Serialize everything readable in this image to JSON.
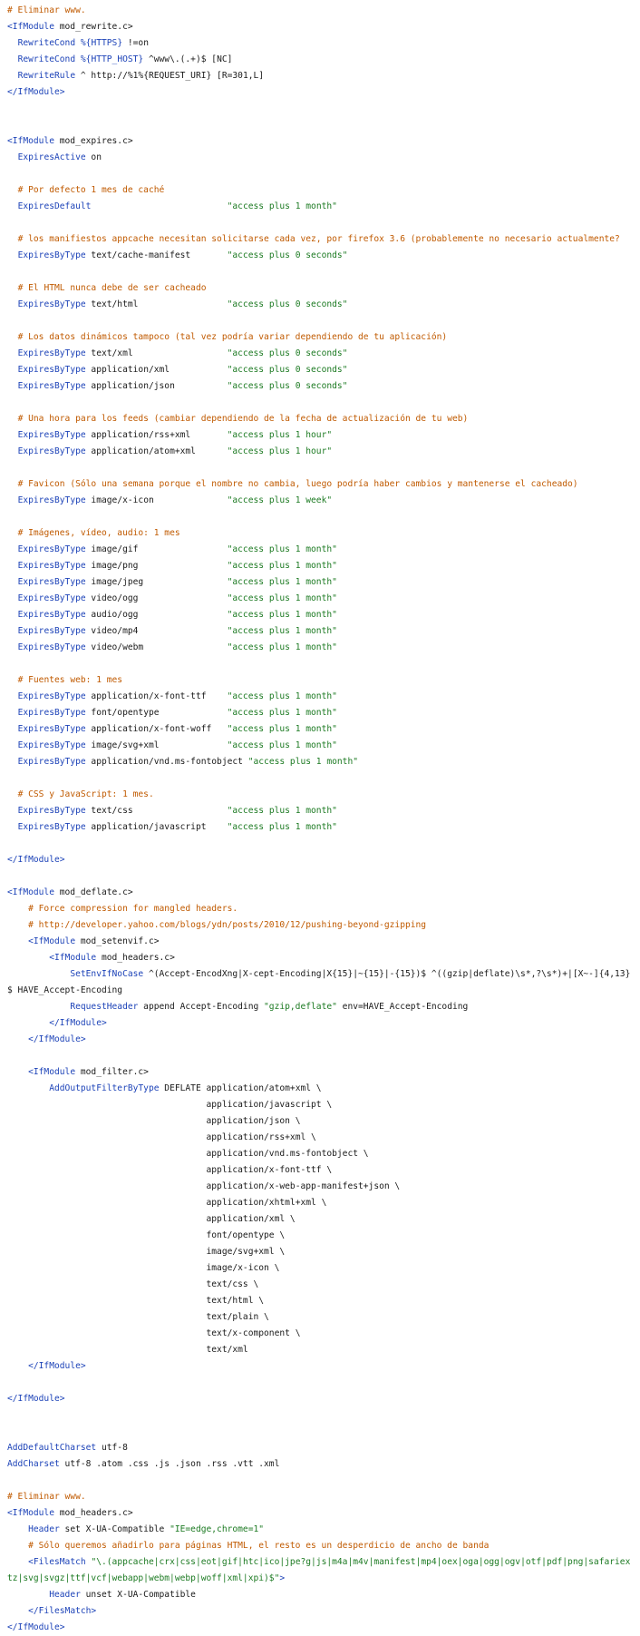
{
  "document": {
    "language": "apache-config",
    "colors": {
      "comment": "#c05a00",
      "directive": "#1d43b8",
      "string": "#1c7a22",
      "text": "#1a1a1a",
      "background": "#ffffff"
    },
    "lines": [
      [
        [
          "c",
          "# Eliminar www."
        ]
      ],
      [
        [
          "d",
          "<IfModule"
        ],
        [
          "t",
          " mod_rewrite.c>"
        ]
      ],
      [
        [
          "t",
          "  "
        ],
        [
          "d",
          "RewriteCond"
        ],
        [
          "t",
          " "
        ],
        [
          "d",
          "%{HTTPS}"
        ],
        [
          "t",
          " !=on"
        ]
      ],
      [
        [
          "t",
          "  "
        ],
        [
          "d",
          "RewriteCond"
        ],
        [
          "t",
          " "
        ],
        [
          "d",
          "%{HTTP_HOST}"
        ],
        [
          "t",
          " ^www\\.(.+)$ [NC]"
        ]
      ],
      [
        [
          "t",
          "  "
        ],
        [
          "d",
          "RewriteRule"
        ],
        [
          "t",
          " ^ http://%1%{REQUEST_URI} [R=301,L]"
        ]
      ],
      [
        [
          "d",
          "</IfModule>"
        ]
      ],
      [],
      [],
      [
        [
          "d",
          "<IfModule"
        ],
        [
          "t",
          " mod_expires.c>"
        ]
      ],
      [
        [
          "t",
          "  "
        ],
        [
          "d",
          "ExpiresActive"
        ],
        [
          "t",
          " on"
        ]
      ],
      [],
      [
        [
          "c",
          "  # Por defecto 1 mes de caché"
        ]
      ],
      [
        [
          "t",
          "  "
        ],
        [
          "d",
          "ExpiresDefault"
        ],
        [
          "t",
          "                          "
        ],
        [
          "s",
          "\"access plus 1 month\""
        ]
      ],
      [],
      [
        [
          "c",
          "  # los manifiestos appcache necesitan solicitarse cada vez, por firefox 3.6 (probablemente no necesario actualmente?"
        ]
      ],
      [
        [
          "t",
          "  "
        ],
        [
          "d",
          "ExpiresByType"
        ],
        [
          "t",
          " text/cache-manifest       "
        ],
        [
          "s",
          "\"access plus 0 seconds\""
        ]
      ],
      [],
      [
        [
          "c",
          "  # El HTML nunca debe de ser cacheado"
        ]
      ],
      [
        [
          "t",
          "  "
        ],
        [
          "d",
          "ExpiresByType"
        ],
        [
          "t",
          " text/html                 "
        ],
        [
          "s",
          "\"access plus 0 seconds\""
        ]
      ],
      [],
      [
        [
          "c",
          "  # Los datos dinámicos tampoco (tal vez podría variar dependiendo de tu aplicación)"
        ]
      ],
      [
        [
          "t",
          "  "
        ],
        [
          "d",
          "ExpiresByType"
        ],
        [
          "t",
          " text/xml                  "
        ],
        [
          "s",
          "\"access plus 0 seconds\""
        ]
      ],
      [
        [
          "t",
          "  "
        ],
        [
          "d",
          "ExpiresByType"
        ],
        [
          "t",
          " application/xml           "
        ],
        [
          "s",
          "\"access plus 0 seconds\""
        ]
      ],
      [
        [
          "t",
          "  "
        ],
        [
          "d",
          "ExpiresByType"
        ],
        [
          "t",
          " application/json          "
        ],
        [
          "s",
          "\"access plus 0 seconds\""
        ]
      ],
      [],
      [
        [
          "c",
          "  # Una hora para los feeds (cambiar dependiendo de la fecha de actualización de tu web)"
        ]
      ],
      [
        [
          "t",
          "  "
        ],
        [
          "d",
          "ExpiresByType"
        ],
        [
          "t",
          " application/rss+xml       "
        ],
        [
          "s",
          "\"access plus 1 hour\""
        ]
      ],
      [
        [
          "t",
          "  "
        ],
        [
          "d",
          "ExpiresByType"
        ],
        [
          "t",
          " application/atom+xml      "
        ],
        [
          "s",
          "\"access plus 1 hour\""
        ]
      ],
      [],
      [
        [
          "c",
          "  # Favicon (Sólo una semana porque el nombre no cambia, luego podría haber cambios y mantenerse el cacheado)"
        ]
      ],
      [
        [
          "t",
          "  "
        ],
        [
          "d",
          "ExpiresByType"
        ],
        [
          "t",
          " image/x-icon              "
        ],
        [
          "s",
          "\"access plus 1 week\""
        ]
      ],
      [],
      [
        [
          "c",
          "  # Imágenes, vídeo, audio: 1 mes"
        ]
      ],
      [
        [
          "t",
          "  "
        ],
        [
          "d",
          "ExpiresByType"
        ],
        [
          "t",
          " image/gif                 "
        ],
        [
          "s",
          "\"access plus 1 month\""
        ]
      ],
      [
        [
          "t",
          "  "
        ],
        [
          "d",
          "ExpiresByType"
        ],
        [
          "t",
          " image/png                 "
        ],
        [
          "s",
          "\"access plus 1 month\""
        ]
      ],
      [
        [
          "t",
          "  "
        ],
        [
          "d",
          "ExpiresByType"
        ],
        [
          "t",
          " image/jpeg                "
        ],
        [
          "s",
          "\"access plus 1 month\""
        ]
      ],
      [
        [
          "t",
          "  "
        ],
        [
          "d",
          "ExpiresByType"
        ],
        [
          "t",
          " video/ogg                 "
        ],
        [
          "s",
          "\"access plus 1 month\""
        ]
      ],
      [
        [
          "t",
          "  "
        ],
        [
          "d",
          "ExpiresByType"
        ],
        [
          "t",
          " audio/ogg                 "
        ],
        [
          "s",
          "\"access plus 1 month\""
        ]
      ],
      [
        [
          "t",
          "  "
        ],
        [
          "d",
          "ExpiresByType"
        ],
        [
          "t",
          " video/mp4                 "
        ],
        [
          "s",
          "\"access plus 1 month\""
        ]
      ],
      [
        [
          "t",
          "  "
        ],
        [
          "d",
          "ExpiresByType"
        ],
        [
          "t",
          " video/webm                "
        ],
        [
          "s",
          "\"access plus 1 month\""
        ]
      ],
      [],
      [
        [
          "c",
          "  # Fuentes web: 1 mes"
        ]
      ],
      [
        [
          "t",
          "  "
        ],
        [
          "d",
          "ExpiresByType"
        ],
        [
          "t",
          " application/x-font-ttf    "
        ],
        [
          "s",
          "\"access plus 1 month\""
        ]
      ],
      [
        [
          "t",
          "  "
        ],
        [
          "d",
          "ExpiresByType"
        ],
        [
          "t",
          " font/opentype             "
        ],
        [
          "s",
          "\"access plus 1 month\""
        ]
      ],
      [
        [
          "t",
          "  "
        ],
        [
          "d",
          "ExpiresByType"
        ],
        [
          "t",
          " application/x-font-woff   "
        ],
        [
          "s",
          "\"access plus 1 month\""
        ]
      ],
      [
        [
          "t",
          "  "
        ],
        [
          "d",
          "ExpiresByType"
        ],
        [
          "t",
          " image/svg+xml             "
        ],
        [
          "s",
          "\"access plus 1 month\""
        ]
      ],
      [
        [
          "t",
          "  "
        ],
        [
          "d",
          "ExpiresByType"
        ],
        [
          "t",
          " application/vnd.ms-fontobject "
        ],
        [
          "s",
          "\"access plus 1 month\""
        ]
      ],
      [],
      [
        [
          "c",
          "  # CSS y JavaScript: 1 mes."
        ]
      ],
      [
        [
          "t",
          "  "
        ],
        [
          "d",
          "ExpiresByType"
        ],
        [
          "t",
          " text/css                  "
        ],
        [
          "s",
          "\"access plus 1 month\""
        ]
      ],
      [
        [
          "t",
          "  "
        ],
        [
          "d",
          "ExpiresByType"
        ],
        [
          "t",
          " application/javascript    "
        ],
        [
          "s",
          "\"access plus 1 month\""
        ]
      ],
      [],
      [
        [
          "d",
          "</IfModule>"
        ]
      ],
      [],
      [
        [
          "d",
          "<IfModule"
        ],
        [
          "t",
          " mod_deflate.c>"
        ]
      ],
      [
        [
          "c",
          "    # Force compression for mangled headers."
        ]
      ],
      [
        [
          "c",
          "    # http://developer.yahoo.com/blogs/ydn/posts/2010/12/pushing-beyond-gzipping"
        ]
      ],
      [
        [
          "t",
          "    "
        ],
        [
          "d",
          "<IfModule"
        ],
        [
          "t",
          " mod_setenvif.c>"
        ]
      ],
      [
        [
          "t",
          "        "
        ],
        [
          "d",
          "<IfModule"
        ],
        [
          "t",
          " mod_headers.c>"
        ]
      ],
      [
        [
          "t",
          "            "
        ],
        [
          "d",
          "SetEnvIfNoCase"
        ],
        [
          "t",
          " ^(Accept-EncodXng|X-cept-Encoding|X{15}|~{15}|-{15})$ ^((gzip|deflate)\\s*,?\\s*)+|[X~-]{4,13}$ HAVE_Accept-Encoding"
        ]
      ],
      [
        [
          "t",
          "            "
        ],
        [
          "d",
          "RequestHeader"
        ],
        [
          "t",
          " append Accept-Encoding "
        ],
        [
          "s",
          "\"gzip,deflate\""
        ],
        [
          "t",
          " env=HAVE_Accept-Encoding"
        ]
      ],
      [
        [
          "t",
          "        "
        ],
        [
          "d",
          "</IfModule>"
        ]
      ],
      [
        [
          "t",
          "    "
        ],
        [
          "d",
          "</IfModule>"
        ]
      ],
      [],
      [
        [
          "t",
          "    "
        ],
        [
          "d",
          "<IfModule"
        ],
        [
          "t",
          " mod_filter.c>"
        ]
      ],
      [
        [
          "t",
          "        "
        ],
        [
          "d",
          "AddOutputFilterByType"
        ],
        [
          "t",
          " DEFLATE application/atom+xml \\"
        ]
      ],
      [
        [
          "t",
          "                                      application/javascript \\"
        ]
      ],
      [
        [
          "t",
          "                                      application/json \\"
        ]
      ],
      [
        [
          "t",
          "                                      application/rss+xml \\"
        ]
      ],
      [
        [
          "t",
          "                                      application/vnd.ms-fontobject \\"
        ]
      ],
      [
        [
          "t",
          "                                      application/x-font-ttf \\"
        ]
      ],
      [
        [
          "t",
          "                                      application/x-web-app-manifest+json \\"
        ]
      ],
      [
        [
          "t",
          "                                      application/xhtml+xml \\"
        ]
      ],
      [
        [
          "t",
          "                                      application/xml \\"
        ]
      ],
      [
        [
          "t",
          "                                      font/opentype \\"
        ]
      ],
      [
        [
          "t",
          "                                      image/svg+xml \\"
        ]
      ],
      [
        [
          "t",
          "                                      image/x-icon \\"
        ]
      ],
      [
        [
          "t",
          "                                      text/css \\"
        ]
      ],
      [
        [
          "t",
          "                                      text/html \\"
        ]
      ],
      [
        [
          "t",
          "                                      text/plain \\"
        ]
      ],
      [
        [
          "t",
          "                                      text/x-component \\"
        ]
      ],
      [
        [
          "t",
          "                                      text/xml"
        ]
      ],
      [
        [
          "t",
          "    "
        ],
        [
          "d",
          "</IfModule>"
        ]
      ],
      [],
      [
        [
          "d",
          "</IfModule>"
        ]
      ],
      [],
      [],
      [
        [
          "d",
          "AddDefaultCharset"
        ],
        [
          "t",
          " utf-8"
        ]
      ],
      [
        [
          "d",
          "AddCharset"
        ],
        [
          "t",
          " utf-8 .atom .css .js .json .rss .vtt .xml"
        ]
      ],
      [],
      [
        [
          "c",
          "# Eliminar www."
        ]
      ],
      [
        [
          "d",
          "<IfModule"
        ],
        [
          "t",
          " mod_headers.c>"
        ]
      ],
      [
        [
          "t",
          "    "
        ],
        [
          "d",
          "Header"
        ],
        [
          "t",
          " set X-UA-Compatible "
        ],
        [
          "s",
          "\"IE=edge,chrome=1\""
        ]
      ],
      [
        [
          "c",
          "    # Sólo queremos añadirlo para páginas HTML, el resto es un desperdicio de ancho de banda"
        ]
      ],
      [
        [
          "t",
          "    "
        ],
        [
          "d",
          "<FilesMatch"
        ],
        [
          "t",
          " "
        ],
        [
          "s",
          "\"\\.(appcache|crx|css|eot|gif|htc|ico|jpe?g|js|m4a|m4v|manifest|mp4|oex|oga|ogg|ogv|otf|pdf|png|safariextz|svg|svgz|ttf|vcf|webapp|webm|webp|woff|xml|xpi)$\""
        ],
        [
          "d",
          ">"
        ]
      ],
      [
        [
          "t",
          "        "
        ],
        [
          "d",
          "Header"
        ],
        [
          "t",
          " unset X-UA-Compatible"
        ]
      ],
      [
        [
          "t",
          "    "
        ],
        [
          "d",
          "</FilesMatch>"
        ]
      ],
      [
        [
          "d",
          "</IfModule>"
        ]
      ]
    ]
  }
}
